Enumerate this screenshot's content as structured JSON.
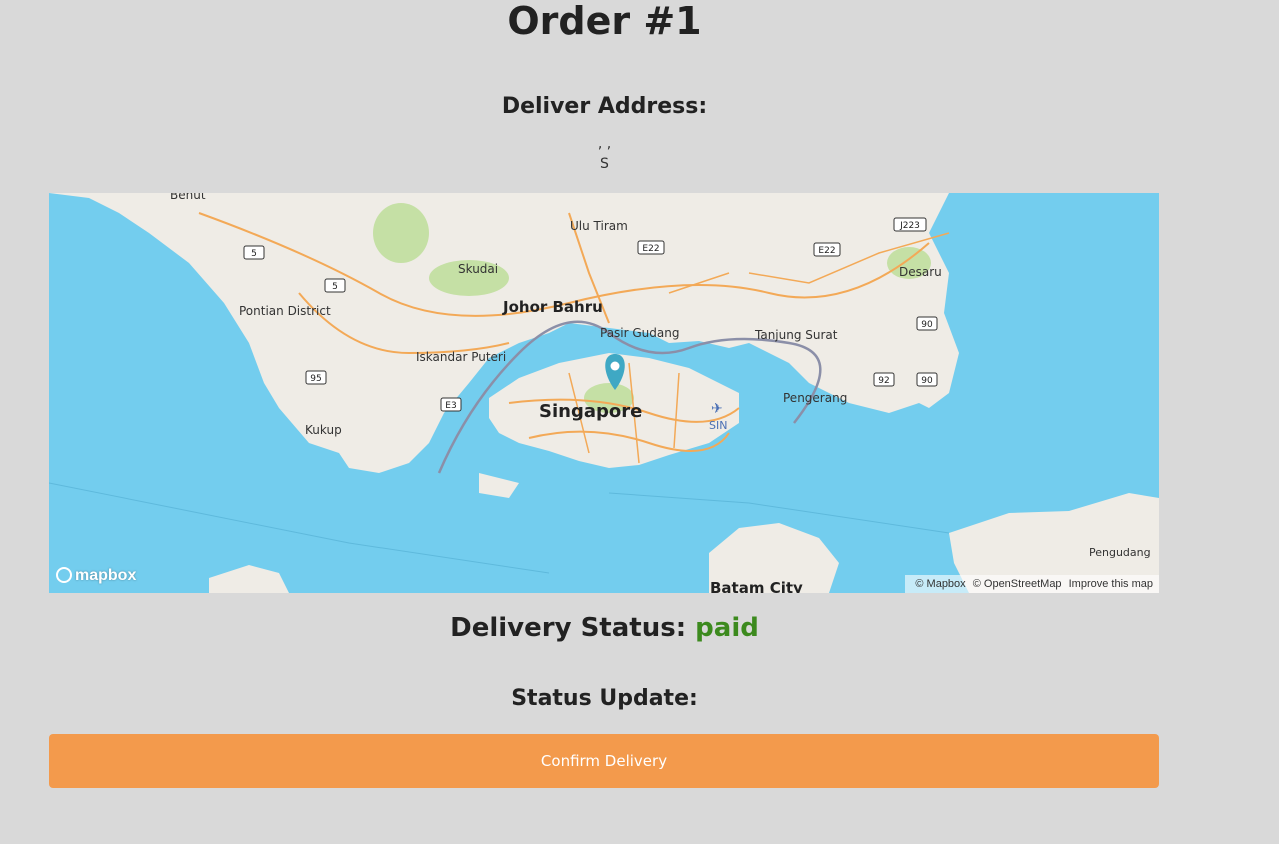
{
  "order": {
    "title": "Order #1"
  },
  "address": {
    "heading": "Deliver Address:",
    "line1": ", ,",
    "line2": "S"
  },
  "map": {
    "labels": {
      "benut": "Benut",
      "ulu_tiram": "Ulu Tiram",
      "skudai": "Skudai",
      "johor_bahru": "Johor Bahru",
      "pontian": "Pontian District",
      "pasir_gudang": "Pasir Gudang",
      "tanjung_surat": "Tanjung Surat",
      "iskandar": "Iskandar Puteri",
      "singapore": "Singapore",
      "desaru": "Desaru",
      "kukup": "Kukup",
      "pengerang": "Pengerang",
      "sin": "SIN",
      "batam": "Batam City",
      "pengudang": "Pengudang"
    },
    "shields": {
      "r5a": "5",
      "r5b": "5",
      "r95": "95",
      "e3": "E3",
      "e22a": "E22",
      "e22b": "E22",
      "j223": "J223",
      "r90a": "90",
      "r90b": "90",
      "r92": "92"
    },
    "logo": "mapbox",
    "attribution": {
      "mapbox": "© Mapbox",
      "osm": "© OpenStreetMap",
      "improve": "Improve this map"
    },
    "colors": {
      "water": "#73cdee",
      "land": "#efece6",
      "park": "#c5e0a5",
      "road": "#f3a957",
      "marker": "#3fa8c4"
    }
  },
  "delivery": {
    "label": "Delivery Status:",
    "value": "paid",
    "value_color": "#3c8a1e"
  },
  "status_update": {
    "heading": "Status Update:"
  },
  "actions": {
    "confirm_label": "Confirm Delivery"
  }
}
